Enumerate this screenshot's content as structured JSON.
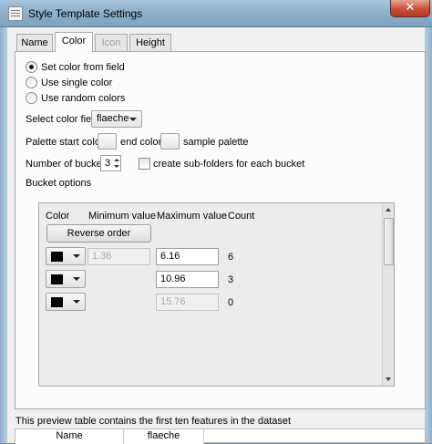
{
  "window": {
    "title": "Style Template Settings",
    "close_glyph": "✕"
  },
  "tabs": [
    {
      "label": "Name",
      "state": "normal"
    },
    {
      "label": "Color",
      "state": "active"
    },
    {
      "label": "Icon",
      "state": "disabled"
    },
    {
      "label": "Height",
      "state": "normal"
    }
  ],
  "color_mode": {
    "options": [
      {
        "label": "Set color from field",
        "checked": true
      },
      {
        "label": "Use single color",
        "checked": false
      },
      {
        "label": "Use random colors",
        "checked": false
      }
    ]
  },
  "color_field": {
    "label": "Select color field",
    "value": "flaeche"
  },
  "palette": {
    "start_label": "Palette start color",
    "end_label": "end color",
    "sample_label": "sample palette"
  },
  "buckets": {
    "label": "Number of buckets",
    "value": "3",
    "subfolders_label": "create sub-folders for each bucket",
    "subfolders_checked": false
  },
  "bucket_options": {
    "label": "Bucket options",
    "headers": {
      "color": "Color",
      "min": "Minimum value",
      "max": "Maximum value",
      "count": "Count"
    },
    "reverse_label": "Reverse order",
    "rows": [
      {
        "color": "#000000",
        "min": "1.36",
        "max": "6.16",
        "count": "6",
        "max_enabled": true
      },
      {
        "color": "#000000",
        "min": "",
        "max": "10.96",
        "count": "3",
        "max_enabled": true
      },
      {
        "color": "#000000",
        "min": "",
        "max": "15.76",
        "count": "0",
        "max_enabled": false
      }
    ]
  },
  "preview": {
    "note": "This preview table contains the first ten features in the dataset",
    "columns": [
      "Name",
      "flaeche"
    ]
  }
}
